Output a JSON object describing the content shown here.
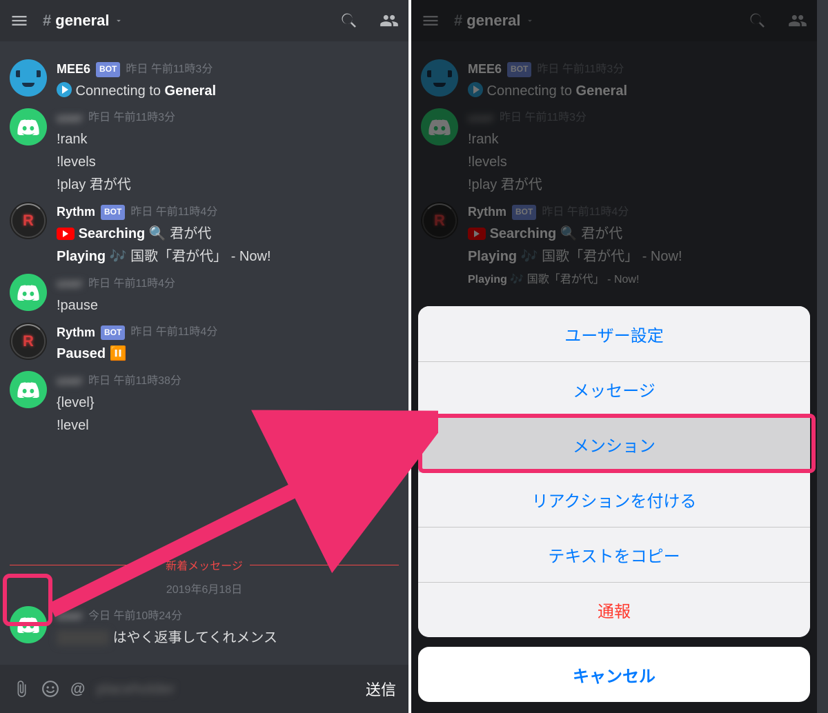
{
  "header": {
    "channel_name": "general"
  },
  "messages": [
    {
      "id": "m1",
      "author": "MEE6",
      "avatar": "mee6",
      "bot": true,
      "timestamp": "昨日 午前11時3分",
      "lines": [
        {
          "pre_icon": "play-circle",
          "text": "Connecting to ",
          "bold_suffix": "General"
        }
      ]
    },
    {
      "id": "m2",
      "author": "user",
      "author_blur": true,
      "avatar": "discord",
      "timestamp": "昨日 午前11時3分",
      "lines": [
        {
          "text": "!rank"
        },
        {
          "text": "!levels"
        },
        {
          "text": "!play 君が代"
        }
      ]
    },
    {
      "id": "m3",
      "author": "Rythm",
      "avatar": "rythm",
      "bot": true,
      "timestamp": "昨日 午前11時4分",
      "lines": [
        {
          "pre_icon": "youtube",
          "bold_prefix": "Searching",
          "text": " 🔍 君が代"
        },
        {
          "bold_prefix": "Playing",
          "text": " 🎶 国歌「君が代」  - Now!"
        }
      ]
    },
    {
      "id": "m4",
      "author": "user",
      "author_blur": true,
      "avatar": "discord",
      "timestamp": "昨日 午前11時4分",
      "lines": [
        {
          "text": "!pause"
        }
      ]
    },
    {
      "id": "m5",
      "author": "Rythm",
      "avatar": "rythm",
      "bot": true,
      "timestamp": "昨日 午前11時4分",
      "lines": [
        {
          "bold_prefix": "Paused",
          "text": " ⏸️"
        }
      ]
    },
    {
      "id": "m6",
      "author": "user",
      "author_blur": true,
      "avatar": "discord",
      "timestamp": "昨日 午前11時38分",
      "lines": [
        {
          "text": "{level}"
        },
        {
          "text": "!level"
        }
      ]
    }
  ],
  "new_divider_label": "新着メッセージ",
  "date_divider_label": "2019年6月18日",
  "last_message": {
    "author_blur": true,
    "avatar": "discord",
    "timestamp": "今日 午前10時24分",
    "line": {
      "prefix_blur": true,
      "text": "はやく返事してくれメンス"
    }
  },
  "composer": {
    "send_label": "送信",
    "mention_prefix": "@"
  },
  "action_sheet": {
    "items": [
      {
        "label": "ユーザー設定",
        "type": "normal"
      },
      {
        "label": "メッセージ",
        "type": "normal"
      },
      {
        "label": "メンション",
        "type": "highlighted"
      },
      {
        "label": "リアクションを付ける",
        "type": "normal"
      },
      {
        "label": "テキストをコピー",
        "type": "normal"
      },
      {
        "label": "通報",
        "type": "destructive"
      }
    ],
    "cancel_label": "キャンセル"
  }
}
